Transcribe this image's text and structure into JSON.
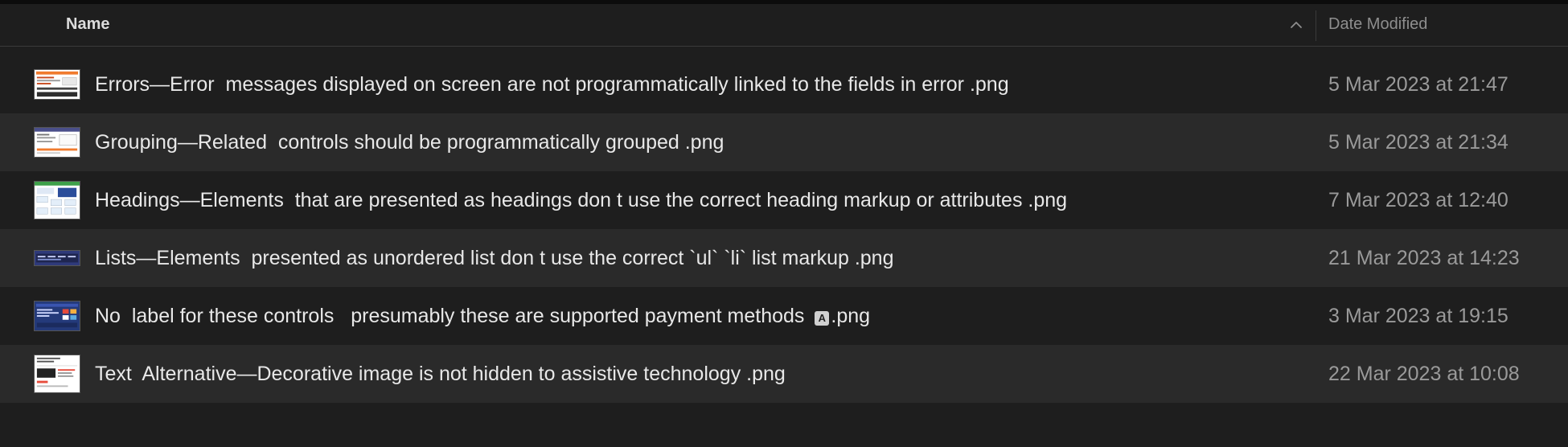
{
  "header": {
    "name_label": "Name",
    "date_label": "Date Modified",
    "sort_icon": "chevron-up-icon"
  },
  "files": [
    {
      "name": "Errors—Error  messages displayed on screen are not programmatically linked to the fields in error .png",
      "date": "5 Mar 2023 at 21:47"
    },
    {
      "name": "Grouping—Related  controls should be programmatically grouped .png",
      "date": "5 Mar 2023 at 21:34"
    },
    {
      "name": "Headings—Elements  that are presented as headings don t use the correct heading markup or attributes .png",
      "date": "7 Mar 2023 at 12:40"
    },
    {
      "name": "Lists—Elements  presented as unordered list don t use the correct `ul` `li` list markup .png",
      "date": "21 Mar 2023 at 14:23"
    },
    {
      "name_prefix": "No  label for these controls   presumably these are supported payment methods ",
      "name_glyph": "A",
      "name_suffix": ".png",
      "date": "3 Mar 2023 at 19:15"
    },
    {
      "name": "Text  Alternative—Decorative image is not hidden to assistive technology .png",
      "date": "22 Mar 2023 at 10:08"
    }
  ],
  "colors": {
    "background": "#1e1e1e",
    "row_alt": "#2a2a2a",
    "text": "#e8e8e8",
    "date_text": "#9a9a9a"
  }
}
